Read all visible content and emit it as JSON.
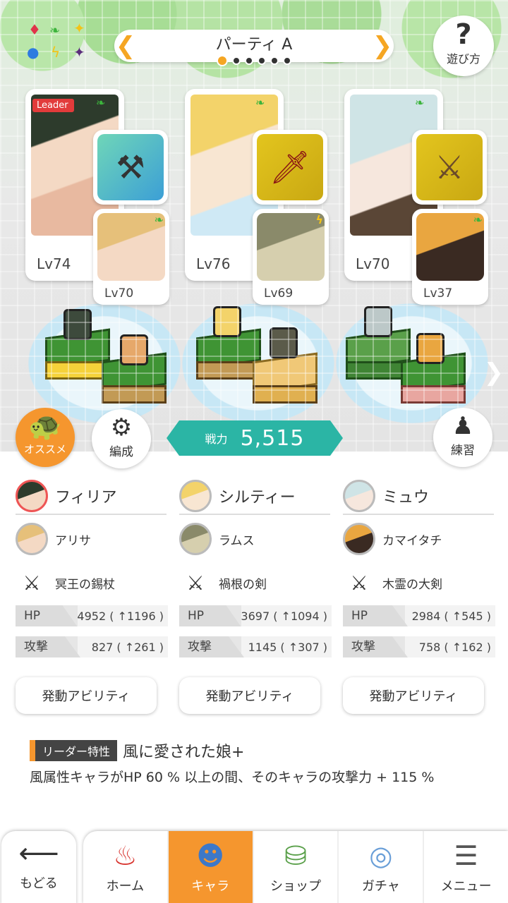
{
  "header": {
    "party_name": "パーティ A",
    "page_count": 6,
    "active_page": 1,
    "help_label": "遊び方"
  },
  "party_cards": [
    {
      "leader_label": "Leader",
      "main_level": "Lv74",
      "sub_level": "Lv70",
      "main_attr": "wind",
      "sub_attr": "wind",
      "weapon": "axe"
    },
    {
      "leader_label": "",
      "main_level": "Lv76",
      "sub_level": "Lv69",
      "main_attr": "wind",
      "sub_attr": "thunder",
      "weapon": "sword"
    },
    {
      "leader_label": "",
      "main_level": "Lv70",
      "sub_level": "Lv37",
      "main_attr": "wind",
      "sub_attr": "wind",
      "weapon": "greatsword"
    }
  ],
  "buttons": {
    "recommend": "オススメ",
    "formation": "編成",
    "practice": "練習"
  },
  "power": {
    "label": "戦力",
    "value": "5,515"
  },
  "members": [
    {
      "name": "フィリア",
      "sub": "アリサ",
      "weapon": "冥王の錫杖",
      "hp_label": "HP",
      "hp": "4952 ( ↑1196 )",
      "atk_label": "攻撃",
      "atk": "827 ( ↑261 )",
      "ability": "発動アビリティ"
    },
    {
      "name": "シルティー",
      "sub": "ラムス",
      "weapon": "禍根の剣",
      "hp_label": "HP",
      "hp": "3697 ( ↑1094 )",
      "atk_label": "攻撃",
      "atk": "1145 ( ↑307 )",
      "ability": "発動アビリティ"
    },
    {
      "name": "ミュウ",
      "sub": "カマイタチ",
      "weapon": "木霊の大剣",
      "hp_label": "HP",
      "hp": "2984 ( ↑545 )",
      "atk_label": "攻撃",
      "atk": "758 ( ↑162 )",
      "ability": "発動アビリティ"
    }
  ],
  "leader_skill": {
    "tag": "リーダー特性",
    "name": "風に愛された娘+",
    "description": "風属性キャラがHP 60 % 以上の間、そのキャラの攻撃力 + 115 %"
  },
  "nav": {
    "back": "もどる",
    "tabs": [
      "ホーム",
      "キャラ",
      "ショップ",
      "ガチャ",
      "メニュー"
    ],
    "active_tab": "キャラ"
  },
  "colors": {
    "accent": "#f5962e",
    "power_teal": "#2bb5a5",
    "leader_red": "#e23b3b",
    "wind_green": "#3cb43c",
    "thunder_yellow": "#f2c318"
  }
}
